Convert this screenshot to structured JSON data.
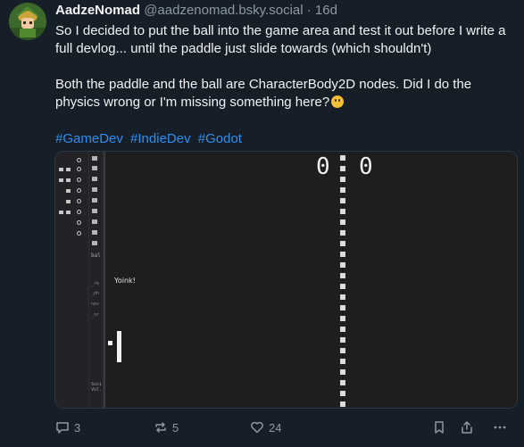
{
  "post": {
    "display_name": "AadzeNomad",
    "handle": "@aadzenomad.bsky.social",
    "separator": "·",
    "time": "16d",
    "text_p1": "So I decided to put the ball into the game area and test it out before I write a full devlog... until the paddle just slide towards (which shouldn't)",
    "text_p2": "Both the paddle and the ball are CharacterBody2D nodes. Did I do the physics wrong or I'm missing something here?",
    "emoji": "thinking-face",
    "hashtags": [
      "#GameDev",
      "#IndieDev",
      "#Godot"
    ]
  },
  "media": {
    "score_left": "0",
    "score_right": "0",
    "yoink_label": "Yoink!",
    "editor_bal_label": "bal",
    "socket_label_1": "Soci",
    "socket_label_2": "Vol.",
    "mid_lines": [
      "_re",
      "_ph",
      "nev",
      "_or"
    ]
  },
  "actions": {
    "reply_count": "3",
    "repost_count": "5",
    "like_count": "24"
  },
  "colors": {
    "background": "#161e27",
    "hashtag": "#2f8ff0",
    "muted": "#8d98a5"
  }
}
